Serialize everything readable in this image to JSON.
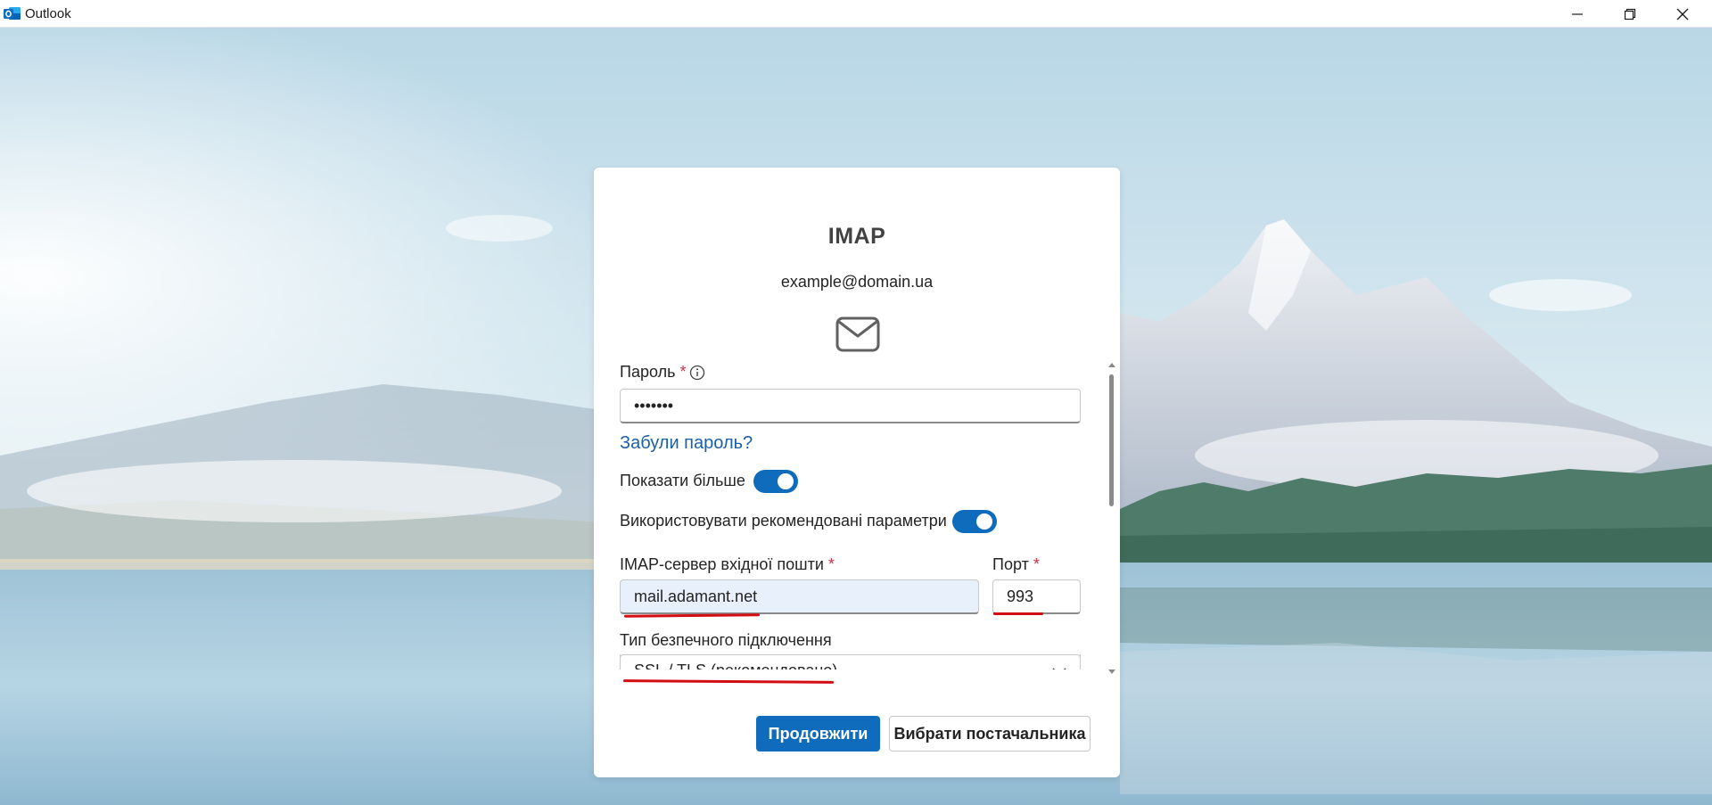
{
  "window": {
    "title": "Outlook",
    "icon": "outlook-icon"
  },
  "dialog": {
    "title": "IMAP",
    "email": "example@domain.ua",
    "icon": "mail-icon"
  },
  "form": {
    "password": {
      "label": "Пароль",
      "required_mark": "*",
      "value": "•••••••"
    },
    "forgot_password_link": "Забули пароль?",
    "show_more": {
      "label": "Показати більше",
      "on": true
    },
    "use_recommended": {
      "label": "Використовувати рекомендовані параметри",
      "on": true
    },
    "imap_server": {
      "label": "IMAP-сервер вхідної пошти",
      "required_mark": "*",
      "value": "mail.adamant.net"
    },
    "port": {
      "label": "Порт",
      "required_mark": "*",
      "value": "993"
    },
    "security_type": {
      "label": "Тип безпечного підключення",
      "value": "SSL / TLS (рекомендовано)"
    }
  },
  "buttons": {
    "continue": "Продовжити",
    "choose_provider": "Вибрати постачальника"
  },
  "colors": {
    "accent": "#0f6cbd",
    "link": "#1b5fa6",
    "required": "#c4314b",
    "annotation": "#d40d12"
  }
}
